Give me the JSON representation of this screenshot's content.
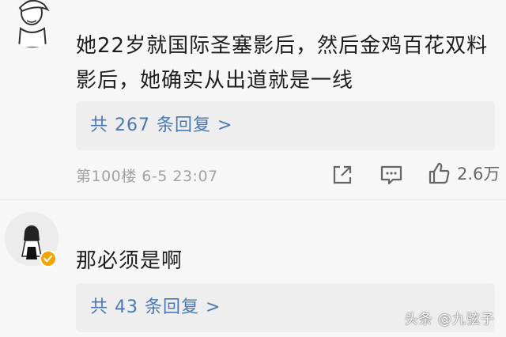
{
  "comments": [
    {
      "text_line1": "她22岁就国际圣塞影后，然后金鸡百花双料",
      "text_line2": "影后，她确实从出道就是一线",
      "reply_link": "共 267 条回复 >",
      "floor_time": "第100楼  6-5 23:07",
      "likes": "2.6万"
    },
    {
      "text": "那必须是啊",
      "reply_link": "共 43 条回复 >"
    }
  ],
  "watermark": "头条 @九弦子",
  "colors": {
    "background": "#f7f7f7",
    "link": "#4a78b4",
    "meta": "#a3a3a3",
    "badge": "#f5a300"
  },
  "icons": [
    "share-icon",
    "comment-icon",
    "thumbs-up-icon",
    "verified-badge-icon"
  ]
}
